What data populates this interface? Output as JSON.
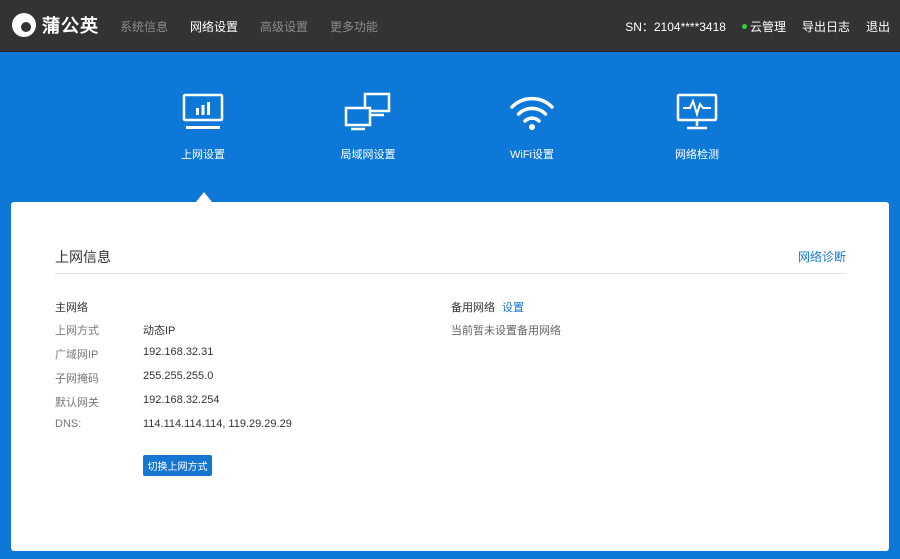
{
  "header": {
    "brand": "蒲公英",
    "nav": [
      "系统信息",
      "网络设置",
      "高级设置",
      "更多功能"
    ],
    "active_nav": "网络设置",
    "sn": "SN：2104****3418",
    "cloud": "云管理",
    "export_log": "导出日志",
    "logout": "退出"
  },
  "tiles": [
    {
      "label": "上网设置",
      "icon": "monitor-chart-icon"
    },
    {
      "label": "局域网设置",
      "icon": "lan-monitors-icon"
    },
    {
      "label": "WiFi设置",
      "icon": "wifi-icon"
    },
    {
      "label": "网络检测",
      "icon": "monitor-pulse-icon"
    }
  ],
  "panel": {
    "title": "上网信息",
    "diagnose": "网络诊断",
    "main_title": "主网络",
    "rows": [
      {
        "label": "上网方式",
        "value": "动态IP"
      },
      {
        "label": "广域网IP",
        "value": "192.168.32.31"
      },
      {
        "label": "子网掩码",
        "value": "255.255.255.0"
      },
      {
        "label": "默认网关",
        "value": "192.168.32.254"
      },
      {
        "label": "DNS:",
        "value": "114.114.114.114, 119.29.29.29"
      }
    ],
    "switch_button": "切换上网方式",
    "backup_title": "备用网络",
    "backup_set": "设置",
    "backup_empty": "当前暂未设置备用网络"
  },
  "colors": {
    "topbar": "#333333",
    "hero": "#0d78d8",
    "accent": "#1677d2",
    "cloud_dot": "#35d03a"
  }
}
